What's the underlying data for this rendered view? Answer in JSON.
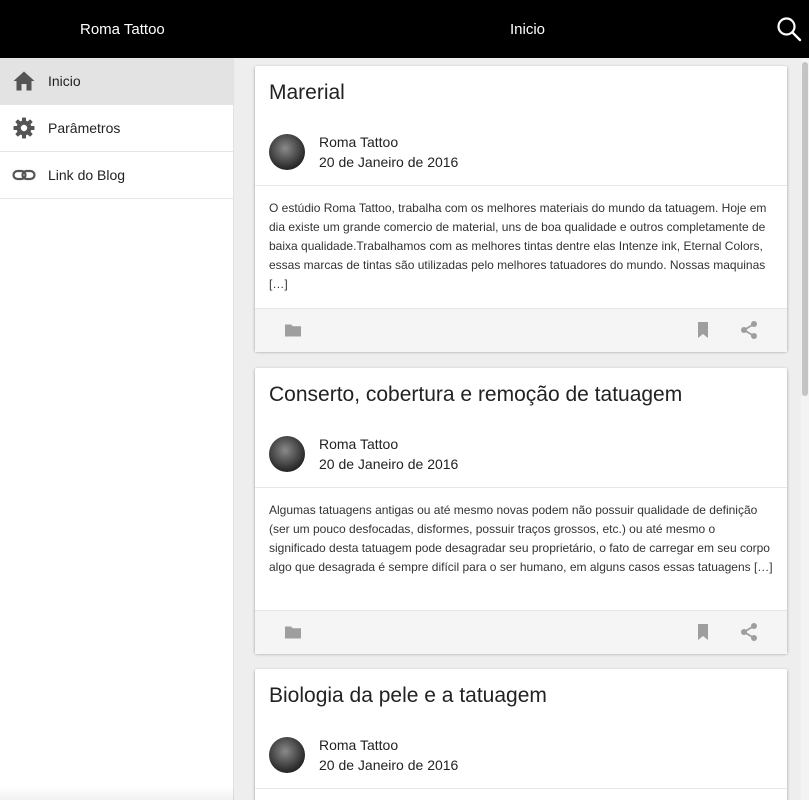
{
  "topbar": {
    "app_title": "Roma Tattoo",
    "page_title": "Inicio",
    "search_icon": "search-icon"
  },
  "sidebar": {
    "items": [
      {
        "label": "Inicio",
        "icon": "home-icon",
        "active": true
      },
      {
        "label": "Parâmetros",
        "icon": "gear-icon",
        "active": false
      },
      {
        "label": "Link do Blog",
        "icon": "link-icon",
        "active": false
      }
    ]
  },
  "posts": [
    {
      "title": "Marerial",
      "author": "Roma Tattoo",
      "date": "20 de Janeiro de 2016",
      "excerpt": "O estúdio Roma Tattoo, trabalha com os melhores materiais do mundo da tatuagem. Hoje em dia existe um grande comercio de material, uns de boa qualidade e outros completamente de baixa qualidade.Trabalhamos com as melhores tintas dentre elas Intenze ink, Eternal Colors, essas marcas de tintas são utilizadas pelo melhores tatuadores do mundo. Nossas maquinas […]"
    },
    {
      "title": "Conserto, cobertura e remoção de tatuagem",
      "author": "Roma Tattoo",
      "date": "20 de Janeiro de 2016",
      "excerpt": "Algumas tatuagens antigas ou até mesmo novas podem não possuir qualidade de definição (ser um pouco desfocadas, disformes, possuir traços grossos, etc.) ou até mesmo o significado desta tatuagem pode desagradar seu proprietário, o fato de carregar em seu corpo algo que desagrada é sempre difícil para o ser humano, em alguns casos essas tatuagens […]"
    },
    {
      "title": "Biologia da pele e a tatuagem",
      "author": "Roma Tattoo",
      "date": "20 de Janeiro de 2016",
      "excerpt": ""
    }
  ],
  "icons": {
    "folder": "folder-icon",
    "bookmark": "bookmark-icon",
    "share": "share-icon"
  },
  "colors": {
    "topbar_bg": "#000000",
    "topbar_text": "#ffffff",
    "active_nav_bg": "#e3e3e3",
    "content_bg": "#eeeeee",
    "icon_gray": "#9e9e9e"
  }
}
